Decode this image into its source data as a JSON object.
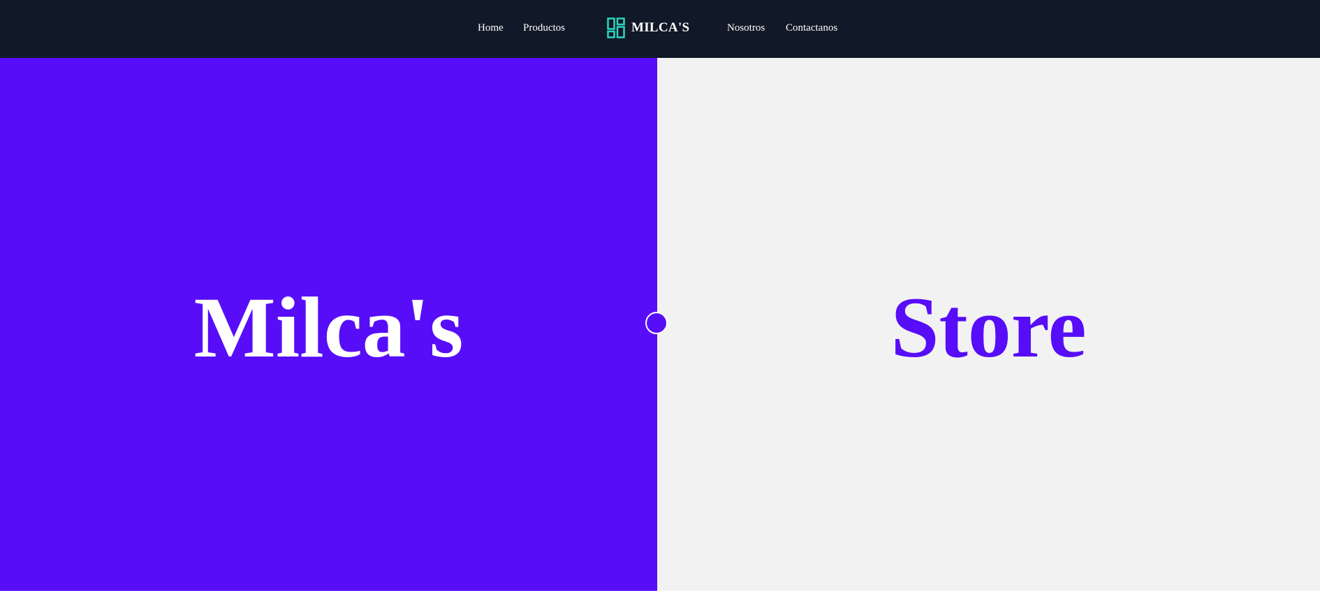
{
  "nav": {
    "links_left": [
      {
        "label": "Home"
      },
      {
        "label": "Productos"
      }
    ],
    "brand": {
      "name": "MILCA'S",
      "icon": "layout-grid-icon",
      "icon_color": "#2dd4bf"
    },
    "links_right": [
      {
        "label": "Nosotros"
      },
      {
        "label": "Contactanos"
      }
    ],
    "background": "#111827"
  },
  "hero": {
    "left_text": "Milca's",
    "right_text": "Store",
    "accent_color": "#570df8",
    "right_background": "#f2f2f2",
    "divider_icon": "slider-handle-icon"
  }
}
